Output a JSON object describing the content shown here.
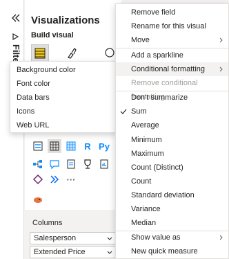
{
  "filters": {
    "label": "Filte"
  },
  "visualizations": {
    "title": "Visualizations",
    "build_visual_label": "Build visual",
    "icon_row3": [
      "table-icon",
      "matrix-icon",
      "R",
      "Py",
      "key-influencers-icon"
    ],
    "columns_label": "Columns",
    "field_wells": [
      "Salesperson",
      "Extended Price"
    ]
  },
  "submenu": {
    "items": [
      "Background color",
      "Font color",
      "Data bars",
      "Icons",
      "Web URL"
    ]
  },
  "context_menu": {
    "items": [
      {
        "label": "Remove field"
      },
      {
        "label": "Rename for this visual"
      },
      {
        "label": "Move",
        "has_submenu": true
      },
      {
        "label": "Add a sparkline"
      },
      {
        "label": "Conditional formatting",
        "has_submenu": true
      },
      {
        "label": "Remove conditional formatting",
        "disabled": true
      },
      {
        "label": "Don't summarize"
      },
      {
        "label": "Sum",
        "checked": true
      },
      {
        "label": "Average"
      },
      {
        "label": "Minimum"
      },
      {
        "label": "Maximum"
      },
      {
        "label": "Count (Distinct)"
      },
      {
        "label": "Count"
      },
      {
        "label": "Standard deviation"
      },
      {
        "label": "Variance"
      },
      {
        "label": "Median"
      },
      {
        "label": "Show value as",
        "has_submenu": true
      },
      {
        "label": "New quick measure"
      }
    ]
  },
  "colors": {
    "accent": "#118dff",
    "selected_bg": "#e1dfdd",
    "disabled_text": "#a19f9d"
  }
}
